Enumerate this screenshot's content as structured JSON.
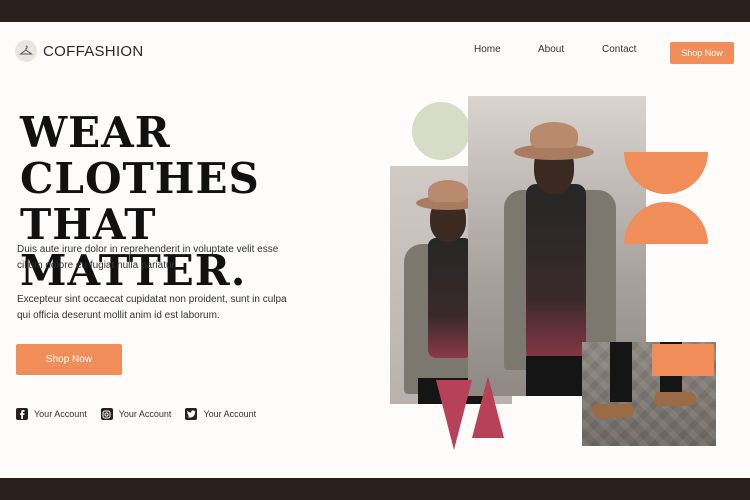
{
  "brand": {
    "name": "COFFASHION",
    "logo_icon": "hanger-icon"
  },
  "nav": {
    "items": [
      "Home",
      "About",
      "Contact"
    ],
    "cta": "Shop Now"
  },
  "hero": {
    "headline_line1": "WEAR CLOTHES",
    "headline_line2": "THAT MATTER.",
    "para1": "Duis aute irure dolor in reprehenderit in voluptate velit esse cillum dolore eu fugiat nulla pariatur.",
    "para2": "Excepteur sint occaecat cupidatat non proident, sunt in culpa qui officia deserunt mollit anim id est laborum.",
    "button": "Shop Now"
  },
  "socials": [
    {
      "icon": "facebook-icon",
      "label": "Your Account"
    },
    {
      "icon": "instagram-icon",
      "label": "Your Account"
    },
    {
      "icon": "twitter-icon",
      "label": "Your Account"
    }
  ],
  "colors": {
    "accent": "#f08d59",
    "frame": "#2a201c",
    "sage": "#d7dcc6",
    "berry": "#b8415a"
  }
}
